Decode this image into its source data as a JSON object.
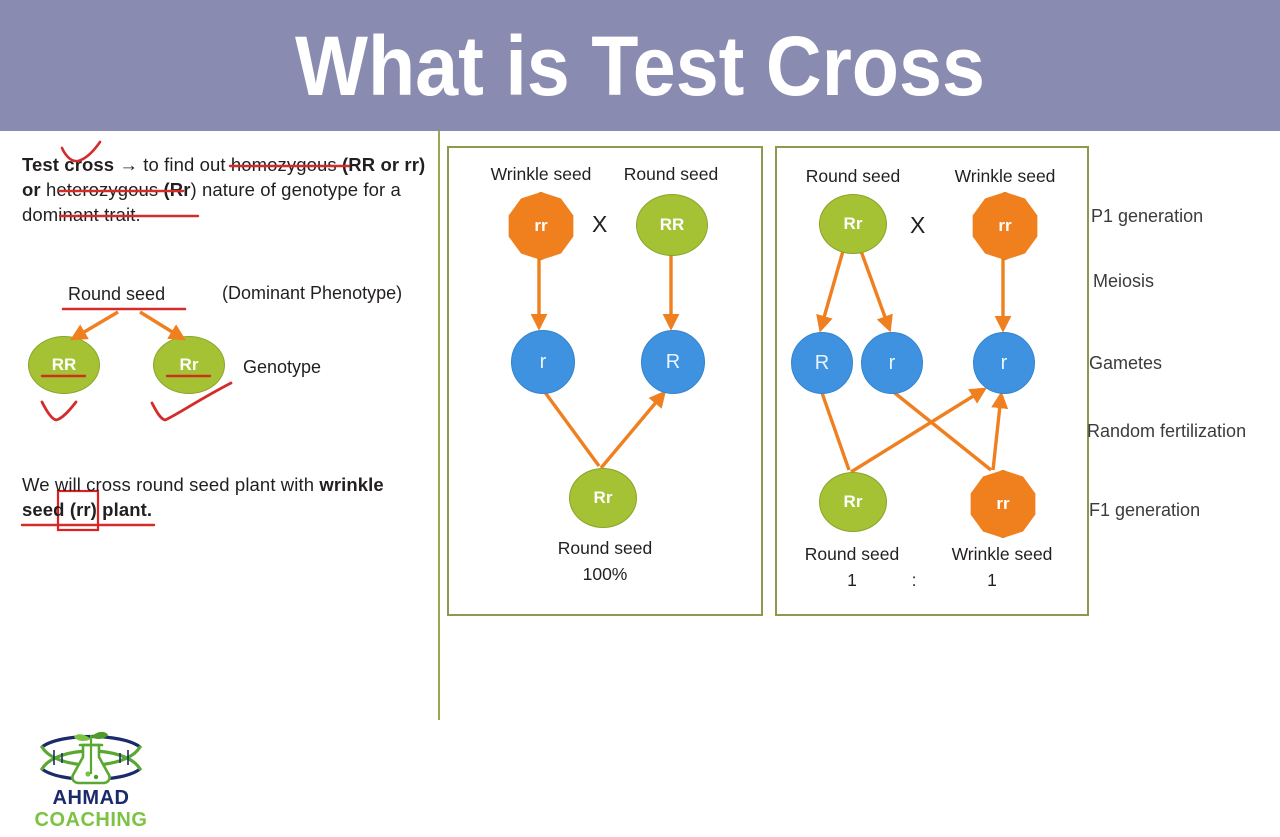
{
  "title": {
    "text": "What is Test Cross",
    "banner_color": "#8a8bb0"
  },
  "colors": {
    "banner": "#8a8bb0",
    "green": "#a5c234",
    "orange": "#f0801e",
    "blue": "#3e92e0",
    "panel_border": "#8d9a4e",
    "annotation_red": "#d42b2b",
    "arrow_orange": "#ef7f1f"
  },
  "left": {
    "definition": {
      "lead": "Test cross",
      "body_1": " → to find out ",
      "underline_1": "homozygous",
      "body_2": " (",
      "bold_1": "RR or rr",
      "body_3": ") or ",
      "underline_2": "heterozygous",
      "body_4": " (",
      "bold_2": "Rr",
      "body_5": ") nature of genotype for a ",
      "underline_3": "dominant trait",
      "body_6": "."
    },
    "round_seed_label": "Round seed",
    "dominant_phenotype_label": "(Dominant Phenotype)",
    "genotype_label": "Genotype",
    "genotypes": [
      {
        "name": "homozygous-dominant",
        "text": "RR"
      },
      {
        "name": "heterozygous",
        "text": "Rr"
      }
    ],
    "cross_statement": {
      "part_1": "We will cross round seed plant with ",
      "bold_1": "wrinkle seed ",
      "boxed": "(rr)",
      "bold_2": " plant",
      "end": "."
    }
  },
  "panel_monohybrid": {
    "parents": [
      {
        "name": "wrinkle-parent",
        "label": "Wrinkle seed",
        "genotype": "rr",
        "shape": "decagon",
        "color": "orange"
      },
      {
        "name": "round-parent",
        "label": "Round seed",
        "genotype": "RR",
        "shape": "circle",
        "color": "green"
      }
    ],
    "cross_symbol": "X",
    "gametes": [
      {
        "name": "gamete-r",
        "allele": "r"
      },
      {
        "name": "gamete-R-capital",
        "allele": "R"
      }
    ],
    "offspring": {
      "name": "f1-offspring",
      "genotype": "Rr",
      "shape": "circle",
      "color": "green"
    },
    "result_line_1": "Round seed",
    "result_line_2": "100%"
  },
  "panel_testcross": {
    "parents": [
      {
        "name": "round-parent",
        "label": "Round seed",
        "genotype": "Rr",
        "shape": "circle",
        "color": "green"
      },
      {
        "name": "wrinkle-parent",
        "label": "Wrinkle seed",
        "genotype": "rr",
        "shape": "decagon",
        "color": "orange"
      }
    ],
    "cross_symbol": "X",
    "gametes": [
      {
        "name": "gamete-R-capital",
        "allele": "R"
      },
      {
        "name": "gamete-r-left",
        "allele": "r"
      },
      {
        "name": "gamete-r-right",
        "allele": "r"
      }
    ],
    "offspring": [
      {
        "name": "f1-round",
        "genotype": "Rr",
        "shape": "circle",
        "color": "green",
        "label": "Round seed",
        "ratio": "1"
      },
      {
        "name": "f1-wrinkle",
        "genotype": "rr",
        "shape": "decagon",
        "color": "orange",
        "label": "Wrinkle seed",
        "ratio": "1"
      }
    ],
    "ratio_separator": ":"
  },
  "stage_labels": [
    {
      "name": "p1-generation",
      "text": "P1 generation"
    },
    {
      "name": "meiosis",
      "text": "Meiosis"
    },
    {
      "name": "gametes",
      "text": "Gametes"
    },
    {
      "name": "random-fertilization",
      "text": "Random fertilization"
    },
    {
      "name": "f1-generation",
      "text": "F1 generation"
    }
  ],
  "logo": {
    "line_1": "AHMAD",
    "line_2": "COACHING"
  }
}
